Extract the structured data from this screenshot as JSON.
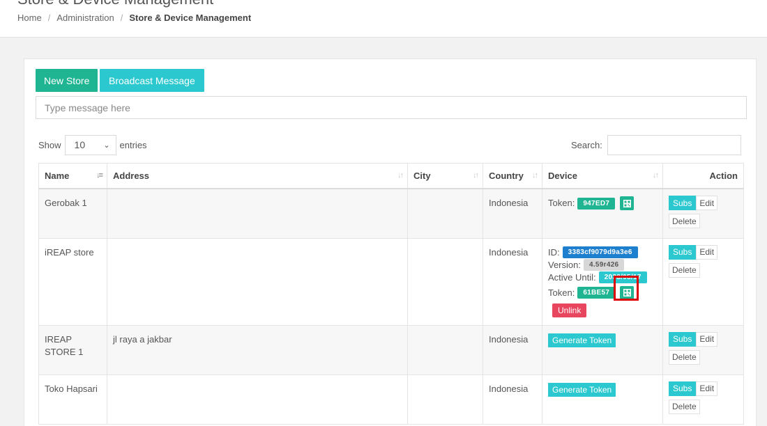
{
  "header": {
    "title": "Store & Device Management",
    "breadcrumb": [
      "Home",
      "Administration",
      "Store & Device Management"
    ]
  },
  "toolbar": {
    "new_store_label": "New Store",
    "broadcast_label": "Broadcast Message",
    "message_placeholder": "Type message here"
  },
  "table_controls": {
    "show_label": "Show",
    "entries_value": "10",
    "entries_label": "entries",
    "search_label": "Search:"
  },
  "columns": [
    "Name",
    "Address",
    "City",
    "Country",
    "Device",
    "Action"
  ],
  "rows": [
    {
      "name": "Gerobak 1",
      "address": "",
      "city": "",
      "country": "Indonesia",
      "device": {
        "token_label": "Token:",
        "token": "947ED7"
      }
    },
    {
      "name": "iREAP store",
      "address": "",
      "city": "",
      "country": "Indonesia",
      "device": {
        "id_label": "ID:",
        "id": "3383cf9079d9a3e6",
        "version_label": "Version:",
        "version": "4.59r426",
        "active_label": "Active Until:",
        "active_until": "2033/05/17",
        "token_label": "Token:",
        "token": "61BE57",
        "unlink_label": "Unlink"
      }
    },
    {
      "name": "IREAP STORE 1",
      "address": "jl raya a jakbar",
      "city": "",
      "country": "Indonesia",
      "device": {
        "generate_label": "Generate Token"
      }
    },
    {
      "name": "Toko Hapsari",
      "address": "",
      "city": "",
      "country": "Indonesia",
      "device": {
        "generate_label": "Generate Token"
      }
    }
  ],
  "actions": {
    "subs": "Subs",
    "edit": "Edit",
    "delete": "Delete"
  },
  "colors": {
    "green": "#1fb492",
    "cyan": "#2bc8cf",
    "blue": "#1e7fcf",
    "red": "#e8455e"
  }
}
